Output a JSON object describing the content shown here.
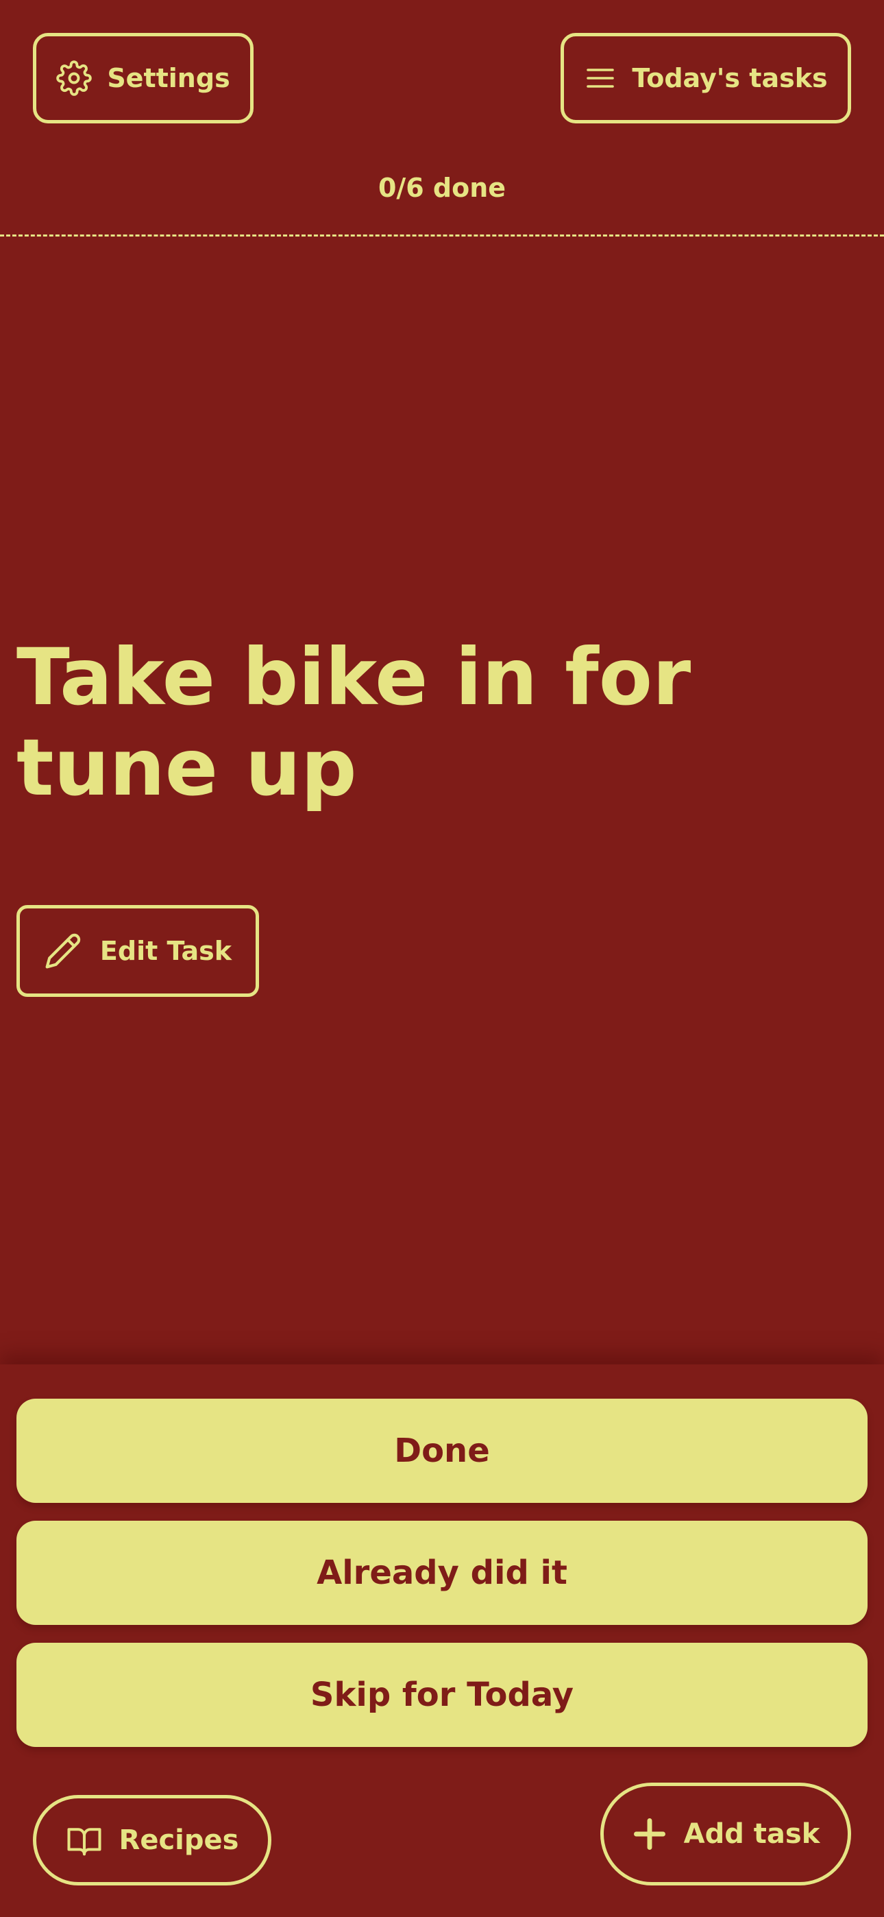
{
  "header": {
    "settings_label": "Settings",
    "settings_icon": "gear-icon",
    "tasks_label": "Today's tasks",
    "tasks_icon": "menu-icon"
  },
  "progress": {
    "completed": 0,
    "total": 6,
    "text": "0/6 done"
  },
  "task": {
    "title": "Take bike in for tune up",
    "edit_label": "Edit Task",
    "edit_icon": "pencil-icon"
  },
  "actions": {
    "done_label": "Done",
    "already_label": "Already did it",
    "skip_label": "Skip for Today"
  },
  "footer": {
    "recipes_label": "Recipes",
    "recipes_icon": "book-icon",
    "add_label": "Add task",
    "add_icon": "plus-icon"
  },
  "colors": {
    "background": "#7f1c18",
    "accent": "#e6e484"
  }
}
